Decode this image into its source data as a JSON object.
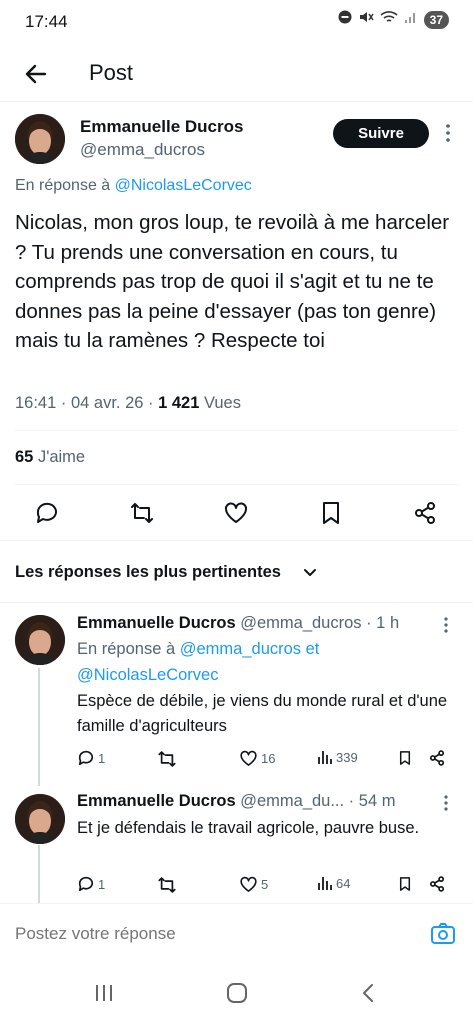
{
  "status_bar": {
    "time": "17:44",
    "battery": "37"
  },
  "header": {
    "title": "Post"
  },
  "tweet": {
    "author_name": "Emmanuelle Ducros",
    "author_handle": "@emma_ducros",
    "follow_label": "Suivre",
    "reply_prefix": "En réponse à ",
    "reply_to": "@NicolasLeCorvec",
    "text": "Nicolas, mon gros loup, te revoilà à me harceler ? Tu prends une conversation en cours, tu comprends pas trop de quoi il s'agit et tu ne te donnes pas la peine d'essayer (pas ton genre) mais tu la ramènes ? Respecte toi",
    "time": "16:41 · 04 avr. 26 · ",
    "views_count": "1 421",
    "views_label": " Vues",
    "likes_count": "65",
    "likes_label": " J'aime"
  },
  "sort": {
    "label": "Les réponses les plus pertinentes"
  },
  "replies": [
    {
      "name": "Emmanuelle Ducros",
      "handle_time": " @emma_ducros · 1 h",
      "reply_prefix": "En réponse à ",
      "reply_to": "@emma_ducros et @NicolasLeCorvec",
      "text": "Espèce de débile, je viens du monde rural et d'une famille d'agriculteurs",
      "comments": "1",
      "retweets": "",
      "likes": "16",
      "views": "339"
    },
    {
      "name": "Emmanuelle Ducros",
      "handle_time": " @emma_du... · 54 m",
      "text": "Et je défendais le travail agricole, pauvre buse.",
      "comments": "1",
      "retweets": "",
      "likes": "5",
      "views": "64"
    }
  ],
  "compose": {
    "placeholder": "Postez votre réponse"
  },
  "colors": {
    "link": "#1d9bf0",
    "text": "#0f1419",
    "muted": "#536471"
  }
}
